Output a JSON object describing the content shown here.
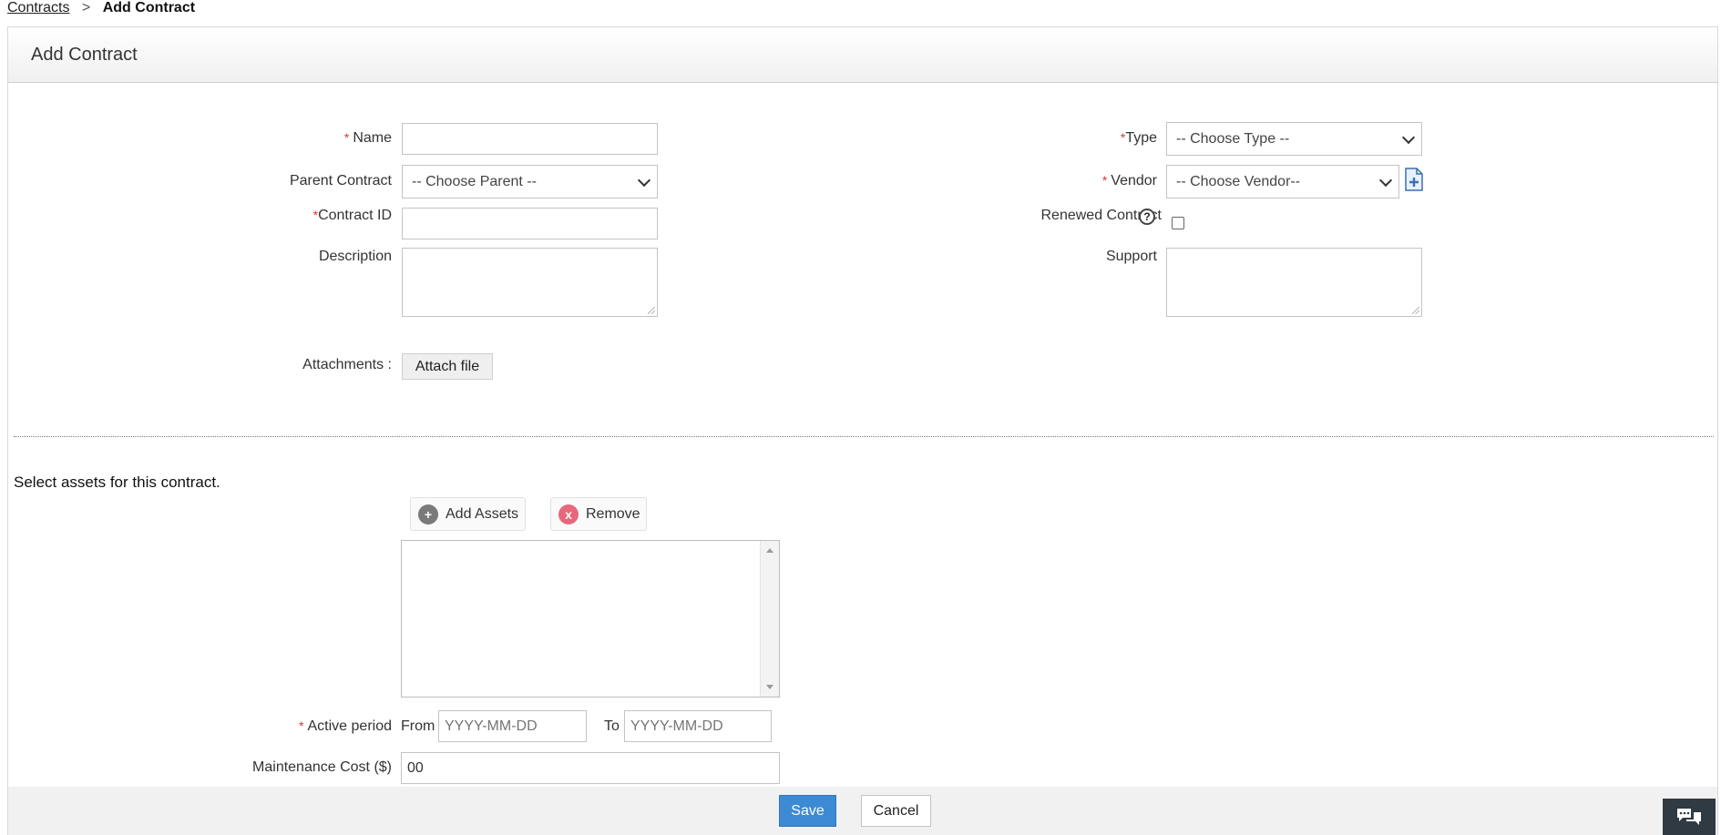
{
  "breadcrumb": {
    "parent": "Contracts",
    "separator": ">",
    "current": "Add Contract"
  },
  "panel": {
    "title": "Add Contract"
  },
  "form": {
    "name_label": "Name",
    "parent_label": "Parent Contract",
    "parent_selected": "-- Choose Parent --",
    "contract_id_label": "Contract ID",
    "description_label": "Description",
    "attachments_label": "Attachments :",
    "attach_button": "Attach file",
    "type_label": "Type",
    "type_selected": "-- Choose Type --",
    "vendor_label": "Vendor",
    "vendor_selected": "-- Choose Vendor--",
    "renewed_label": "Renewed Contract",
    "help_glyph": "?",
    "support_label": "Support",
    "required_mark": "*"
  },
  "assets": {
    "section_title": "Select assets for this contract.",
    "add_button": "Add Assets",
    "add_glyph": "+",
    "remove_button": "Remove",
    "remove_glyph": "x"
  },
  "period": {
    "label": "Active period",
    "from_label": "From",
    "from_placeholder": "YYYY-MM-DD",
    "to_label": "To",
    "to_placeholder": "YYYY-MM-DD"
  },
  "cost": {
    "label": "Maintenance Cost ($)",
    "value": "00"
  },
  "actions": {
    "save": "Save",
    "cancel": "Cancel"
  },
  "colors": {
    "accent": "#3d8ad4",
    "required": "#e03232",
    "remove_icon": "#e8677a",
    "add_icon": "#7a7a7a",
    "chat_bg": "#2f3a43"
  },
  "icons": {
    "new_vendor": "add-document-icon",
    "chat": "chat-bubbles-icon"
  }
}
